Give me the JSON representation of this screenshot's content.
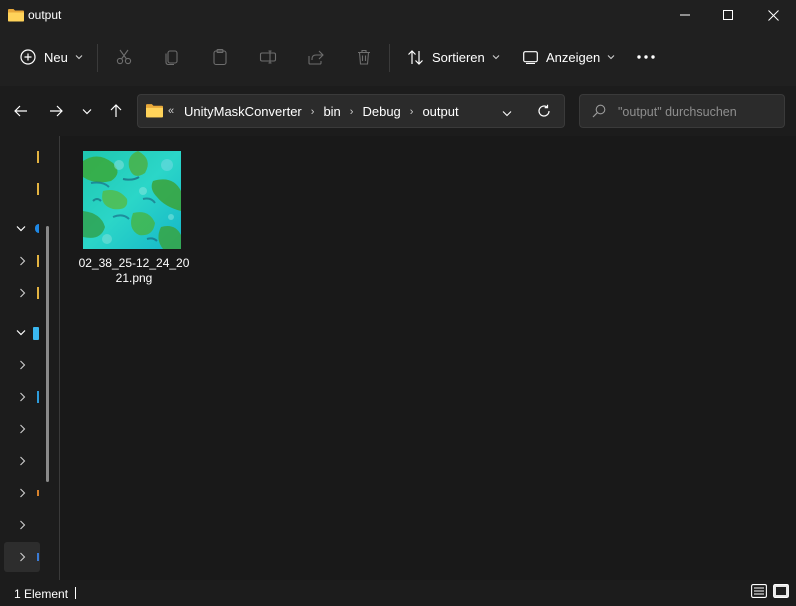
{
  "window": {
    "title": "output"
  },
  "toolbar": {
    "new_label": "Neu",
    "sort_label": "Sortieren",
    "view_label": "Anzeigen",
    "icons": [
      "new-icon",
      "cut-icon",
      "copy-icon",
      "paste-icon",
      "rename-icon",
      "share-icon",
      "delete-icon",
      "sort-icon",
      "view-icon",
      "more-icon"
    ]
  },
  "address": {
    "lead": "«",
    "crumbs": [
      "UnityMaskConverter",
      "bin",
      "Debug",
      "output"
    ]
  },
  "search": {
    "placeholder": "\"output\" durchsuchen"
  },
  "files": [
    {
      "name": "02_38_25-12_24_2021.png"
    }
  ],
  "status": {
    "count": "1 Element"
  },
  "colors": {
    "accent": "#ffd35a",
    "window_bg": "#202020",
    "content_bg": "#191919"
  }
}
